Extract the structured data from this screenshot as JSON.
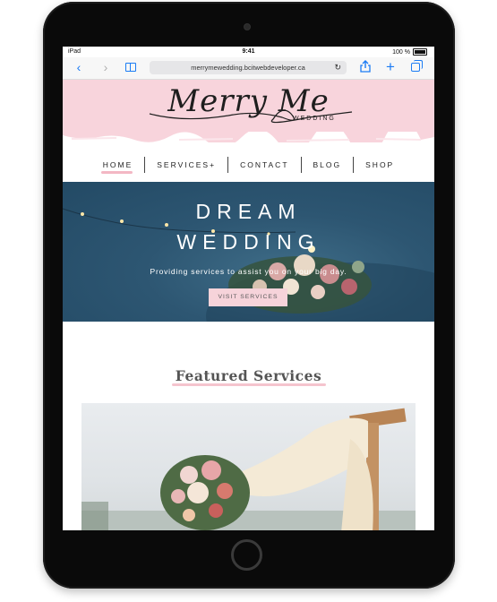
{
  "status_bar": {
    "device": "iPad",
    "time": "9:41",
    "battery": "100 %"
  },
  "browser": {
    "url": "merrymewedding.bcitwebdeveloper.ca"
  },
  "logo": {
    "script": "Merry Me",
    "subtitle": "WEDDING"
  },
  "nav": {
    "items": [
      {
        "label": "HOME"
      },
      {
        "label": "SERVICES+"
      },
      {
        "label": "CONTACT"
      },
      {
        "label": "BLOG"
      },
      {
        "label": "SHOP"
      }
    ]
  },
  "hero": {
    "title_line1": "DREAM",
    "title_line2": "WEDDING",
    "subtitle": "Providing services to assist you on your big day.",
    "cta": "VISIT SERVICES"
  },
  "featured": {
    "heading": "Featured Services"
  },
  "colors": {
    "accent_pink": "#f8d4dc",
    "safari_blue": "#1c7cf4",
    "hero_blue": "#2d5672"
  }
}
